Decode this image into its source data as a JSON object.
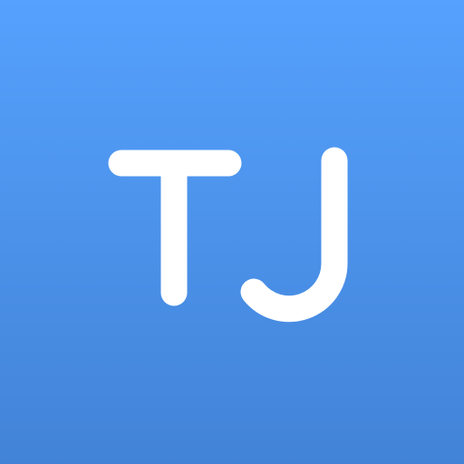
{
  "avatar": {
    "initials": "TJ",
    "background_top": "#55a1fd",
    "background_bottom": "#4283d7",
    "glyph_color": "#ffffff"
  }
}
